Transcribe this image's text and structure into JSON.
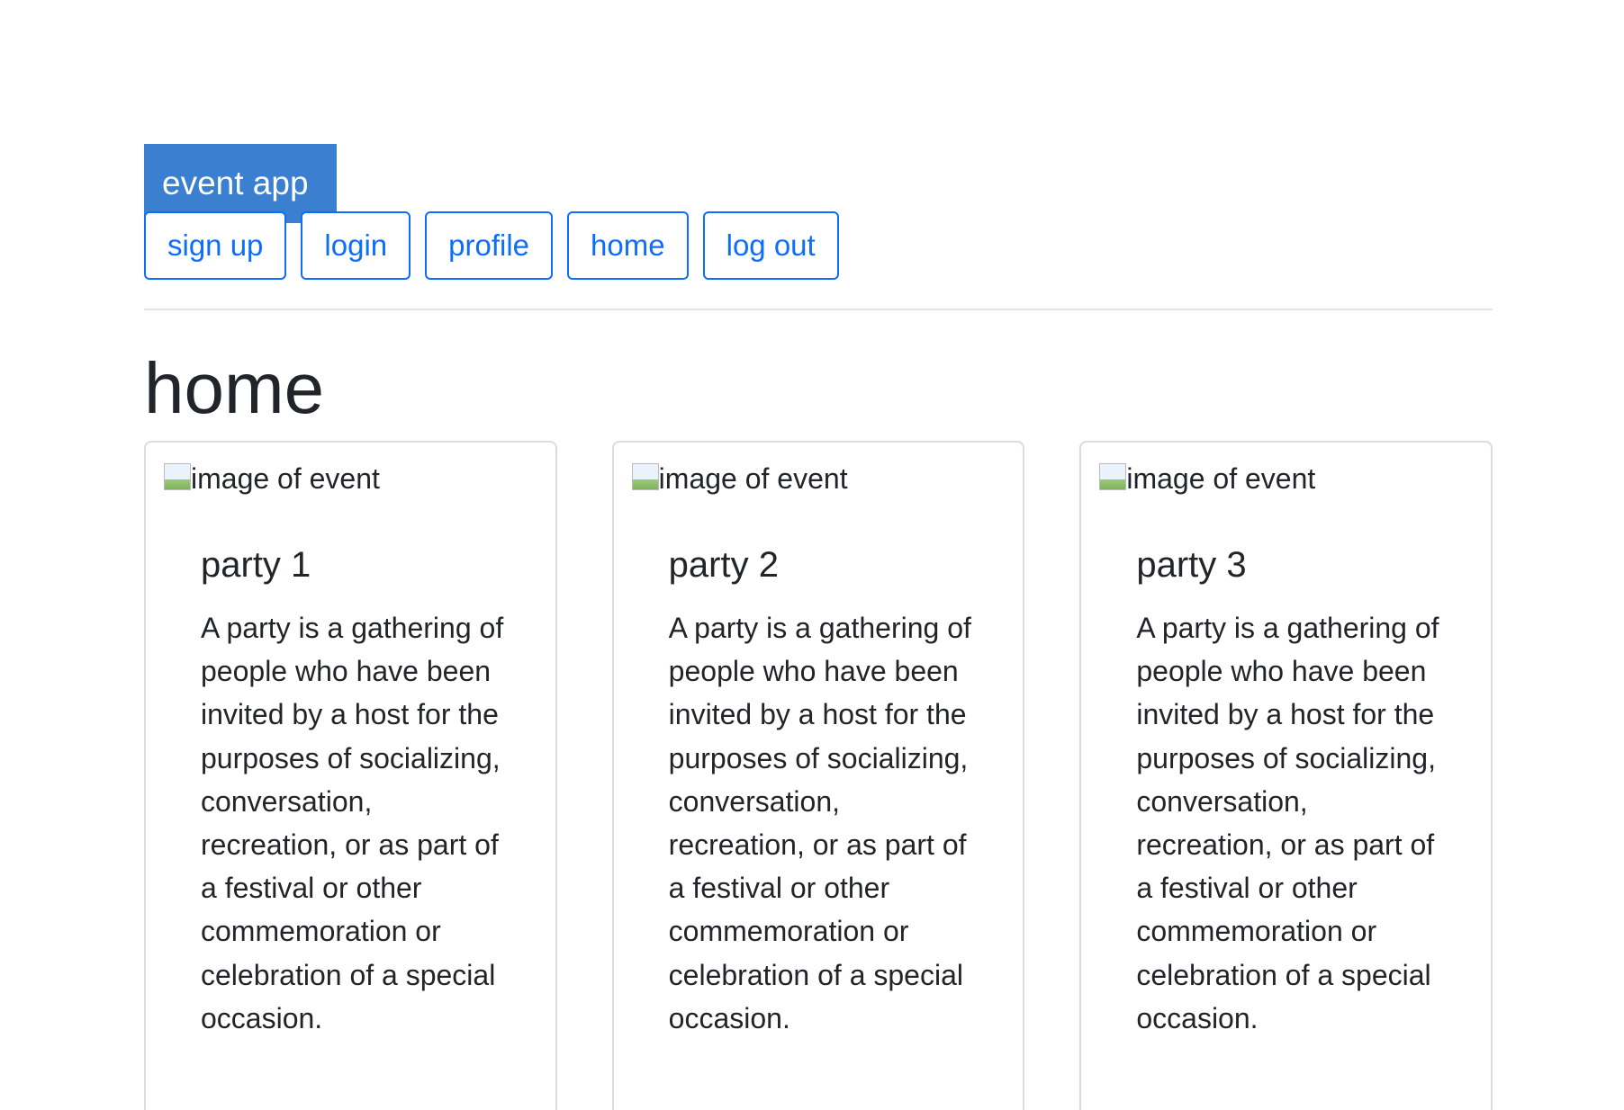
{
  "navbar": {
    "brand": "event app",
    "links": [
      {
        "label": "sign up"
      },
      {
        "label": "login"
      },
      {
        "label": "profile"
      },
      {
        "label": "home"
      },
      {
        "label": "log out"
      }
    ]
  },
  "main": {
    "title": "home",
    "cards": [
      {
        "image_alt": "image of event",
        "title": "party 1",
        "text": "A party is a gathering of people who have been invited by a host for the purposes of socializing, conversation, recreation, or as part of a festival or other commemoration or celebration of a special occasion."
      },
      {
        "image_alt": "image of event",
        "title": "party 2",
        "text": "A party is a gathering of people who have been invited by a host for the purposes of socializing, conversation, recreation, or as part of a festival or other commemoration or celebration of a special occasion."
      },
      {
        "image_alt": "image of event",
        "title": "party 3",
        "text": "A party is a gathering of people who have been invited by a host for the purposes of socializing, conversation, recreation, or as part of a festival or other commemoration or celebration of a special occasion."
      }
    ]
  },
  "colors": {
    "brand_bg": "#3a7fd0",
    "link": "#0d6efd",
    "text": "#212529",
    "border": "#dcdcdc"
  },
  "icons": {
    "card_image": "broken-image-icon"
  }
}
